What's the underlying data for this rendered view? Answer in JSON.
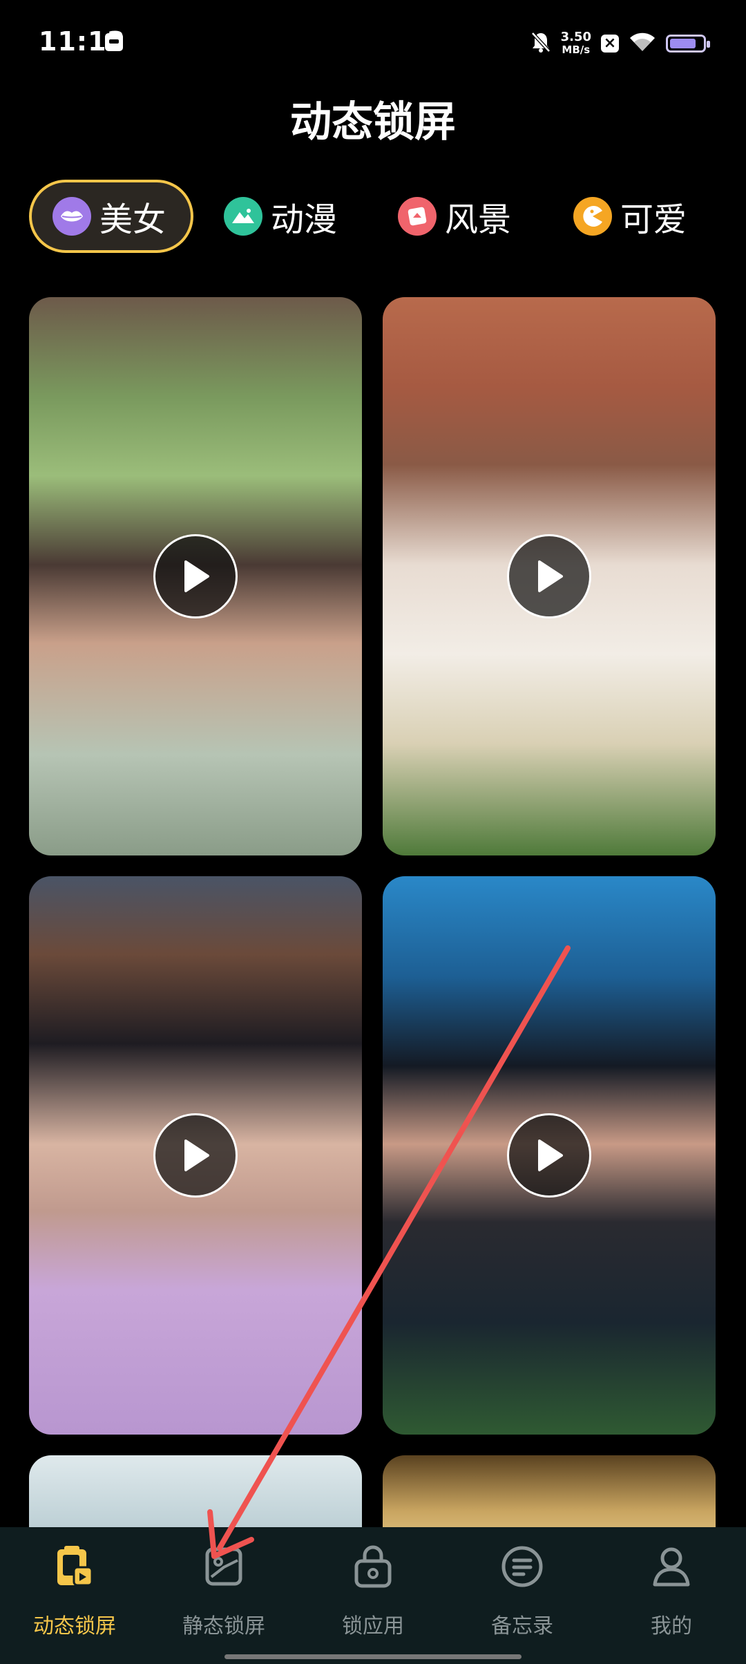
{
  "status_bar": {
    "time": "11:13",
    "net_speed_value": "3.50",
    "net_speed_unit": "MB/s",
    "battery_level": 0.8,
    "icons": [
      "box-notification-icon",
      "bell-muted-icon",
      "x-app-icon",
      "wifi-icon",
      "battery-icon"
    ]
  },
  "header": {
    "title": "动态锁屏"
  },
  "categories": [
    {
      "label": "美女",
      "icon": "lips-icon",
      "color": "#a07ae8",
      "active": true
    },
    {
      "label": "动漫",
      "icon": "mountain-icon",
      "color": "#2fc39a",
      "active": false
    },
    {
      "label": "风景",
      "icon": "card-icon",
      "color": "#f0646c",
      "active": false
    },
    {
      "label": "可爱",
      "icon": "pacman-icon",
      "color": "#f5a623",
      "active": false
    }
  ],
  "accent_color": "#f5c64a",
  "wallpapers": [
    {
      "type": "video",
      "icon": "play-icon"
    },
    {
      "type": "video",
      "icon": "play-icon"
    },
    {
      "type": "video",
      "icon": "play-icon"
    },
    {
      "type": "video",
      "icon": "play-icon"
    },
    {
      "type": "video",
      "icon": "play-icon"
    },
    {
      "type": "video",
      "icon": "play-icon"
    }
  ],
  "tabs": [
    {
      "label": "动态锁屏",
      "icon": "dynamic-lockscreen-icon",
      "active": true
    },
    {
      "label": "静态锁屏",
      "icon": "static-lockscreen-icon",
      "active": false
    },
    {
      "label": "锁应用",
      "icon": "lock-app-icon",
      "active": false
    },
    {
      "label": "备忘录",
      "icon": "memo-icon",
      "active": false
    },
    {
      "label": "我的",
      "icon": "profile-icon",
      "active": false
    }
  ]
}
